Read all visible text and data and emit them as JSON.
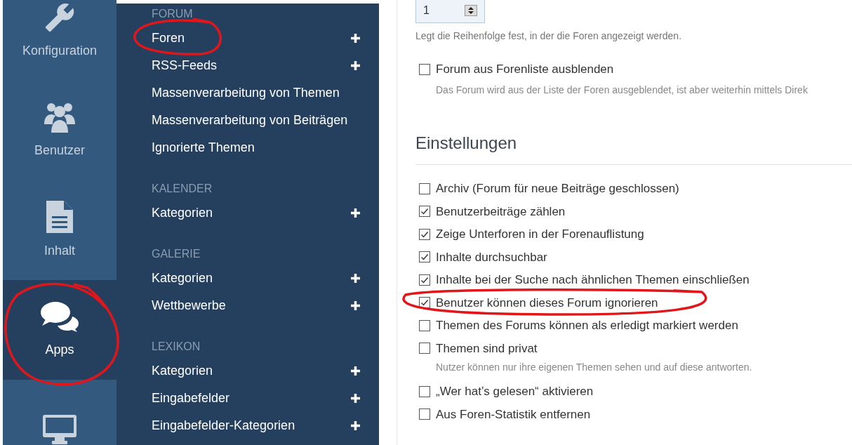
{
  "icon_bar": [
    {
      "kind": "wrench",
      "label": "Konfiguration",
      "selected": false
    },
    {
      "kind": "users",
      "label": "Benutzer",
      "selected": false
    },
    {
      "kind": "document",
      "label": "Inhalt",
      "selected": false
    },
    {
      "kind": "chat",
      "label": "Apps",
      "selected": true
    },
    {
      "kind": "monitor",
      "selected": false
    }
  ],
  "menu": [
    {
      "heading": "FORUM",
      "items": [
        {
          "label": "Foren",
          "add": true
        },
        {
          "label": "RSS-Feeds",
          "add": true
        },
        {
          "label": "Massenverarbeitung von Themen",
          "add": false
        },
        {
          "label": "Massenverarbeitung von Beiträgen",
          "add": false
        },
        {
          "label": "Ignorierte Themen",
          "add": false
        }
      ]
    },
    {
      "heading": "KALENDER",
      "items": [
        {
          "label": "Kategorien",
          "add": true
        }
      ]
    },
    {
      "heading": "GALERIE",
      "items": [
        {
          "label": "Kategorien",
          "add": true
        },
        {
          "label": "Wettbewerbe",
          "add": true
        }
      ]
    },
    {
      "heading": "LEXIKON",
      "items": [
        {
          "label": "Kategorien",
          "add": true
        },
        {
          "label": "Eingabefelder",
          "add": true
        },
        {
          "label": "Eingabefelder-Kategorien",
          "add": true
        }
      ]
    }
  ],
  "order_field": {
    "value": "1",
    "hint": "Legt die Reihenfolge fest, in der die Foren angezeigt werden."
  },
  "hide_option": {
    "label": "Forum aus Forenliste ausblenden",
    "checked": false,
    "hint": "Das Forum wird aus der Liste der Foren ausgeblendet, ist aber weiterhin mittels Direk"
  },
  "settings": {
    "title": "Einstellungen",
    "options": [
      {
        "label": "Archiv (Forum für neue Beiträge geschlossen)",
        "checked": false
      },
      {
        "label": "Benutzerbeiträge zählen",
        "checked": true
      },
      {
        "label": "Zeige Unterforen in der Forenauflistung",
        "checked": true
      },
      {
        "label": "Inhalte durchsuchbar",
        "checked": true
      },
      {
        "label": "Inhalte bei der Suche nach ähnlichen Themen einschließen",
        "checked": true
      },
      {
        "label": "Benutzer können dieses Forum ignorieren",
        "checked": true
      },
      {
        "label": "Themen des Forums können als erledigt markiert werden",
        "checked": false
      },
      {
        "label": "Themen sind privat",
        "checked": false,
        "hint": "Nutzer können nur ihre eigenen Themen sehen und auf diese antworten."
      },
      {
        "label": "„Wer hat’s gelesen“ aktivieren",
        "checked": false
      },
      {
        "label": "Aus Foren-Statistik entfernen",
        "checked": false
      }
    ]
  }
}
